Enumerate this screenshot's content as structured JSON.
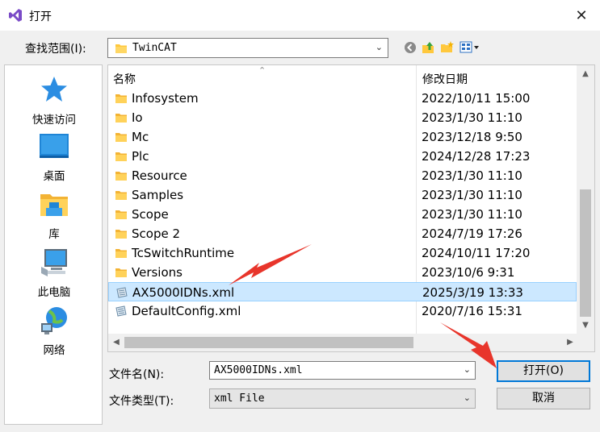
{
  "window": {
    "title": "打开",
    "close_glyph": "✕"
  },
  "lookin": {
    "label": "查找范围(I):",
    "value": "TwinCAT"
  },
  "places": [
    {
      "label": "快速访问",
      "icon": "star-icon"
    },
    {
      "label": "桌面",
      "icon": "desktop-icon"
    },
    {
      "label": "库",
      "icon": "library-icon"
    },
    {
      "label": "此电脑",
      "icon": "computer-icon"
    },
    {
      "label": "网络",
      "icon": "network-icon"
    }
  ],
  "columns": {
    "name": "名称",
    "date": "修改日期"
  },
  "files": [
    {
      "name": "Infosystem",
      "date": "2022/10/11 15:00",
      "type": "folder"
    },
    {
      "name": "Io",
      "date": "2023/1/30 11:10",
      "type": "folder"
    },
    {
      "name": "Mc",
      "date": "2023/12/18 9:50",
      "type": "folder"
    },
    {
      "name": "Plc",
      "date": "2024/12/28 17:23",
      "type": "folder"
    },
    {
      "name": "Resource",
      "date": "2023/1/30 11:10",
      "type": "folder"
    },
    {
      "name": "Samples",
      "date": "2023/1/30 11:10",
      "type": "folder"
    },
    {
      "name": "Scope",
      "date": "2023/1/30 11:10",
      "type": "folder"
    },
    {
      "name": "Scope 2",
      "date": "2024/7/19 17:26",
      "type": "folder"
    },
    {
      "name": "TcSwitchRuntime",
      "date": "2024/10/11 17:20",
      "type": "folder"
    },
    {
      "name": "Versions",
      "date": "2023/10/6 9:31",
      "type": "folder"
    },
    {
      "name": "AX5000IDNs.xml",
      "date": "2025/3/19 13:33",
      "type": "xml",
      "selected": true
    },
    {
      "name": "DefaultConfig.xml",
      "date": "2020/7/16 15:31",
      "type": "xml"
    }
  ],
  "filename": {
    "label": "文件名(N):",
    "value": "AX5000IDNs.xml"
  },
  "filetype": {
    "label": "文件类型(T):",
    "value": "xml File"
  },
  "buttons": {
    "open": "打开(O)",
    "cancel": "取消"
  },
  "colors": {
    "selection": "#cce8ff",
    "accent": "#0078d7",
    "folder": "#ffc83d",
    "annotation_arrow": "#e8352b"
  }
}
